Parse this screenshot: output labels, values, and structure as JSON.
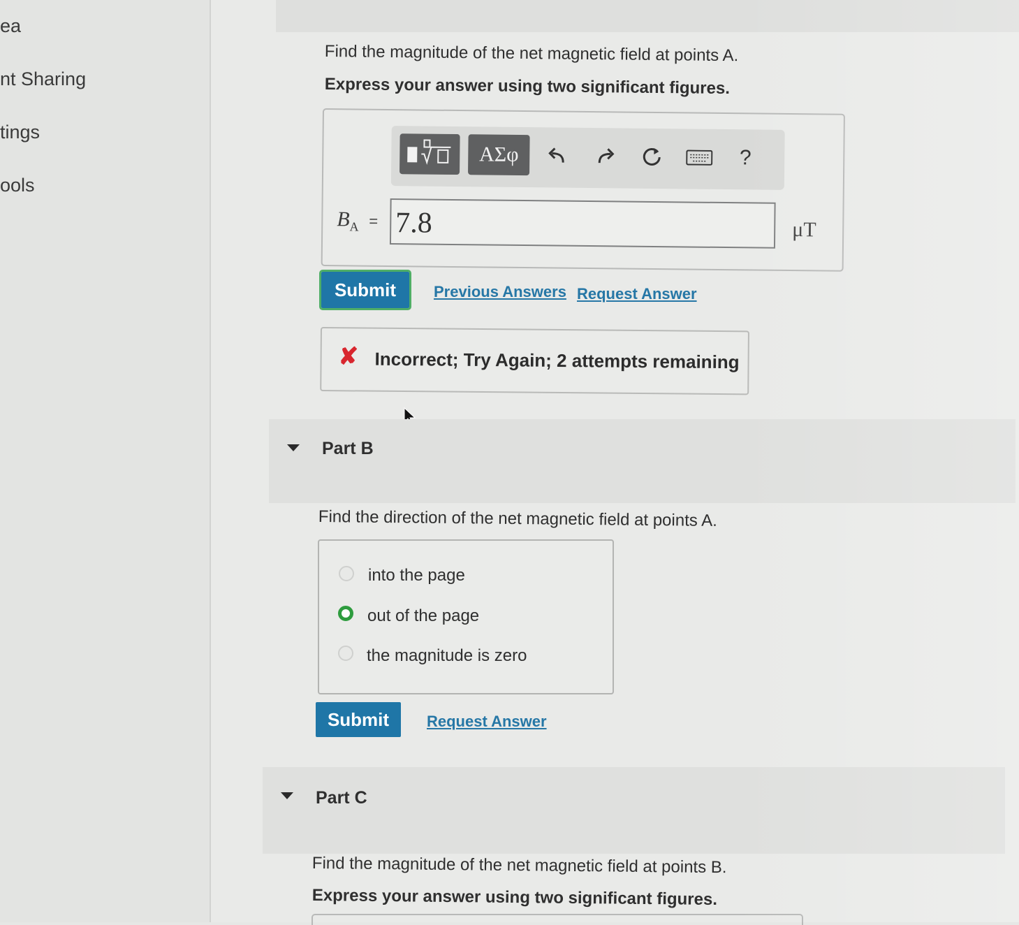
{
  "sidebar": {
    "items": [
      {
        "label": "ea"
      },
      {
        "label": "nt Sharing"
      },
      {
        "label": "tings"
      },
      {
        "label": "ools"
      }
    ]
  },
  "part_a": {
    "question": "Find the magnitude of the net magnetic field at points A.",
    "instruction": "Express your answer using two significant figures.",
    "toolbar": {
      "templates_icon": "fraction-sqrt-template-icon",
      "symbols_label": "ΑΣφ",
      "undo_icon": "undo-icon",
      "redo_icon": "redo-icon",
      "reset_icon": "reset-icon",
      "keyboard_icon": "keyboard-icon",
      "help_label": "?"
    },
    "variable": "B",
    "variable_sub": "A",
    "equals": "=",
    "answer_value": "7.8",
    "unit": "μT",
    "submit_label": "Submit",
    "previous_answers_label": "Previous Answers",
    "request_answer_label": "Request Answer",
    "feedback": {
      "icon": "incorrect-x-icon",
      "text": "Incorrect; Try Again; 2 attempts remaining",
      "color": "#d8262e"
    }
  },
  "part_b": {
    "title": "Part B",
    "question": "Find the direction of the net magnetic field at points A.",
    "options": [
      {
        "label": "into the page",
        "selected": false
      },
      {
        "label": "out of the page",
        "selected": true
      },
      {
        "label": "the magnitude is zero",
        "selected": false
      }
    ],
    "submit_label": "Submit",
    "request_answer_label": "Request Answer"
  },
  "part_c": {
    "title": "Part C",
    "question": "Find the magnitude of the net magnetic field at points B.",
    "instruction": "Express your answer using two significant figures."
  },
  "colors": {
    "accent": "#1f76a7",
    "link": "#2677a6",
    "selected_radio": "#2e9c3e",
    "error": "#d8262e"
  }
}
